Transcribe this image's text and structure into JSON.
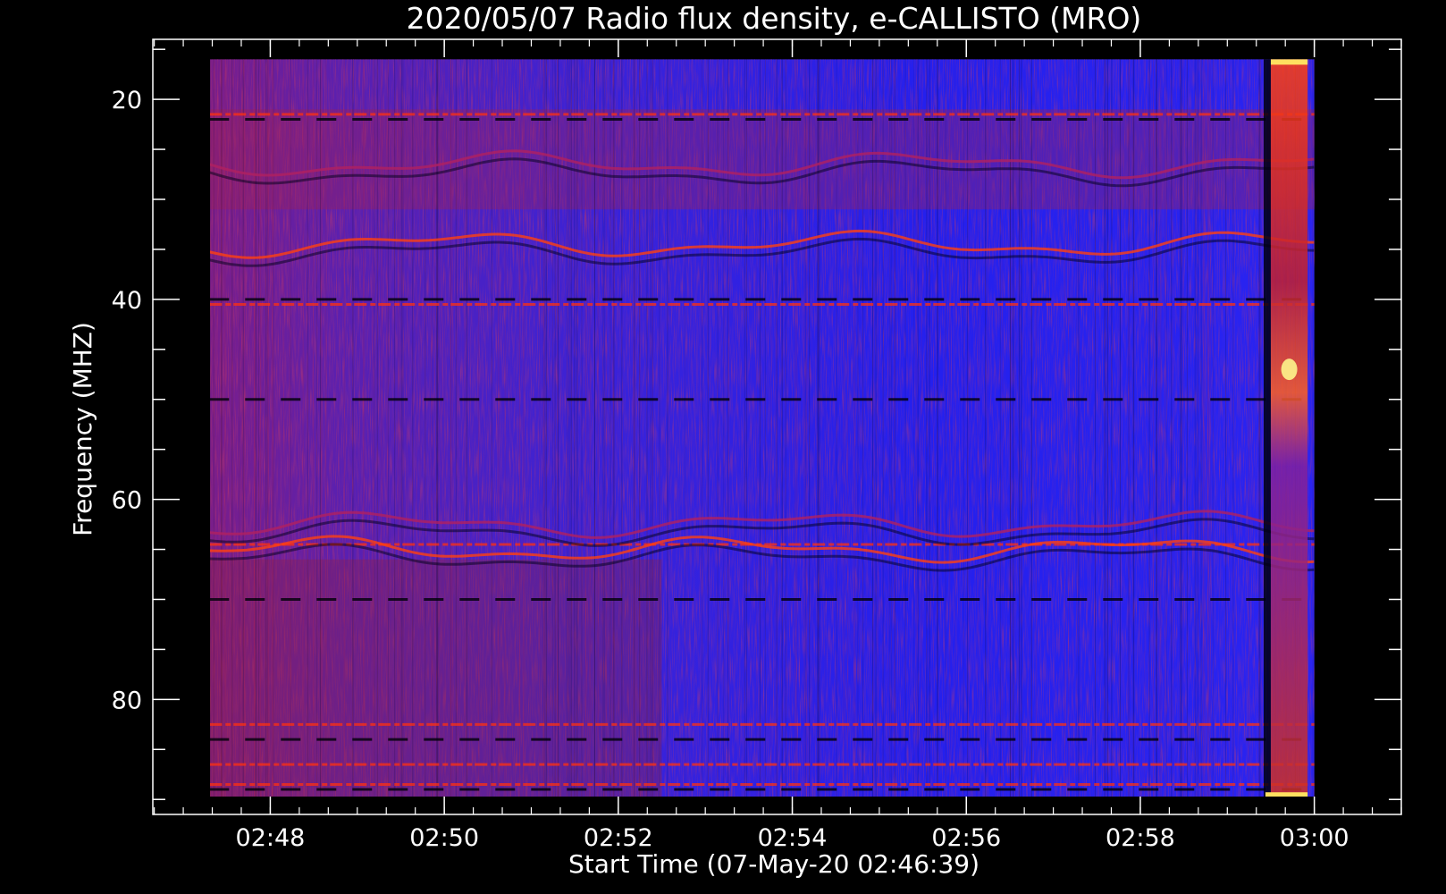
{
  "chart_data": {
    "type": "heatmap",
    "title": "2020/05/07  Radio flux density, e-CALLISTO (MRO)",
    "xlabel": "Start Time (07-May-20 02:46:39)",
    "ylabel": "Frequency (MHZ)",
    "x_ticks": [
      "02:48",
      "02:50",
      "02:52",
      "02:54",
      "02:56",
      "02:58",
      "03:00"
    ],
    "x_tick_minutes": [
      168,
      170,
      172,
      174,
      176,
      178,
      180
    ],
    "xlim_minutes": [
      166.65,
      181.0
    ],
    "data_x_range_minutes": [
      167.3,
      180.0
    ],
    "y_ticks": [
      "20",
      "40",
      "60",
      "80"
    ],
    "y_tick_values": [
      20,
      40,
      60,
      80
    ],
    "ylim": [
      14,
      91.5
    ],
    "y_inverted": true,
    "data_y_range": [
      16,
      90
    ],
    "colormap": [
      "#000000",
      "#2020ff",
      "#b01040",
      "#ff3000",
      "#ffff80"
    ],
    "features": {
      "horizontal_bright_lines_mhz": [
        21.5,
        40.5,
        64.5,
        82.5,
        86.5,
        88.5
      ],
      "horizontal_dark_lines_mhz": [
        22,
        40,
        50,
        70,
        84,
        89
      ],
      "wavy_bands_mhz": [
        26.5,
        34.5,
        62.5,
        65
      ],
      "vertical_burst_minutes": [
        179.5,
        179.8
      ]
    },
    "grid": false,
    "legend": "none"
  }
}
